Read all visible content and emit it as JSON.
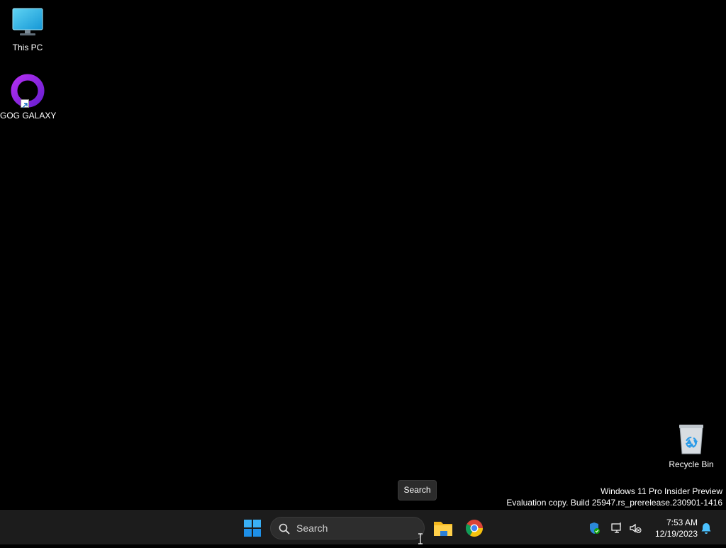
{
  "desktop": {
    "icons": [
      {
        "label": "This PC",
        "icon": "monitor-icon"
      },
      {
        "label": "GOG GALAXY",
        "icon": "gog-galaxy-ring-icon"
      },
      {
        "label": "Recycle Bin",
        "icon": "recycle-bin-icon"
      }
    ],
    "watermark": {
      "line1": "Windows 11 Pro Insider Preview",
      "line2": "Evaluation copy. Build 25947.rs_prerelease.230901-1416"
    },
    "tooltip": "Search"
  },
  "taskbar": {
    "start_icon": "windows-logo-icon",
    "search": {
      "placeholder": "Search"
    },
    "apps": [
      {
        "name": "File Explorer",
        "icon": "folder-icon"
      },
      {
        "name": "Google Chrome",
        "icon": "chrome-icon"
      }
    ],
    "tray": {
      "time": "7:53 AM",
      "date": "12/19/2023"
    }
  },
  "colors": {
    "desktop_bg": "#000000",
    "taskbar_bg": "#1c1c1c",
    "windows_blue": "#0078d4",
    "gog_purple": "#8a2be2"
  }
}
